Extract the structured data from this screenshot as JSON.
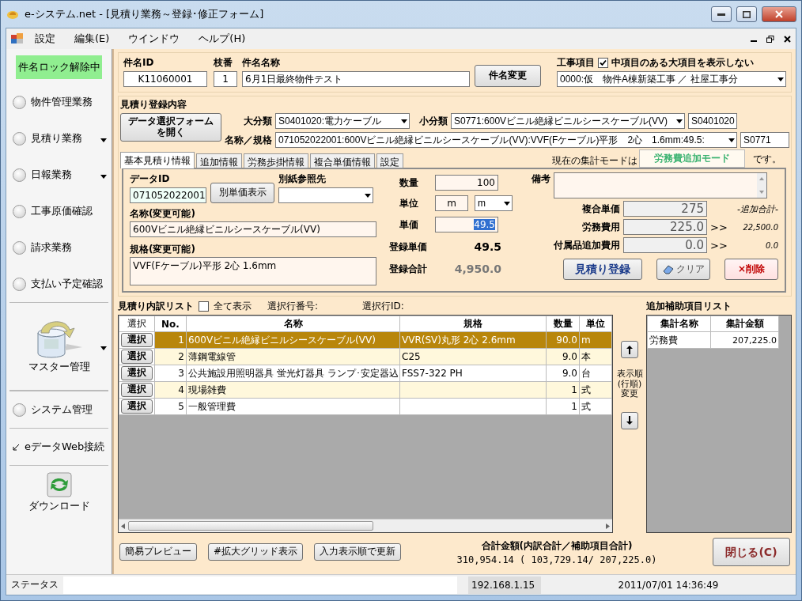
{
  "window": {
    "title": "e-システム.net - [見積り業務～登録･修正フォーム]"
  },
  "menu": [
    {
      "label": "設定"
    },
    {
      "label": "編集(E)"
    },
    {
      "label": "ウインドウ"
    },
    {
      "label": "ヘルプ(H)"
    }
  ],
  "sidebar": {
    "lock_badge": "件名ロック解除中",
    "items": [
      {
        "kind": "radio",
        "label": "物件管理業務",
        "selected": false,
        "has_menu": false
      },
      {
        "kind": "radio",
        "label": "見積り業務",
        "selected": false,
        "has_menu": true
      },
      {
        "kind": "radio",
        "label": "日報業務",
        "selected": false,
        "has_menu": true
      },
      {
        "kind": "radio",
        "label": "工事原価確認",
        "selected": false,
        "has_menu": false
      },
      {
        "kind": "radio",
        "label": "請求業務",
        "selected": false,
        "has_menu": false
      },
      {
        "kind": "radio",
        "label": "支払い予定確認",
        "selected": false,
        "has_menu": false
      },
      {
        "kind": "large",
        "label": "マスター管理",
        "has_menu": true
      },
      {
        "kind": "radio",
        "label": "システム管理",
        "selected": false,
        "has_menu": false
      },
      {
        "kind": "link",
        "label": "eデータWeb接続"
      },
      {
        "kind": "download",
        "label": "ダウンロード"
      }
    ]
  },
  "header": {
    "case_id_label": "件名ID",
    "case_id": "K11060001",
    "branch_label": "枝番",
    "branch": "1",
    "case_name_label": "件名名称",
    "case_name": "6月1日最終物件テスト",
    "change_button": "件名変更",
    "work_label": "工事項目",
    "hide_checkbox": {
      "label": "中項目のある大項目を表示しない",
      "checked": true
    },
    "work_select": "0000:仮　物件A棟新築工事 ／ 社屋工事分"
  },
  "registration": {
    "title": "見積り登録内容",
    "open_button": [
      "データ選択フォーム",
      "を開く"
    ],
    "major_label": "大分類",
    "major_select": "S0401020:電力ケーブル",
    "minor_label": "小分類",
    "minor_select": "S0771:600Vビニル絶縁ビニルシースケーブル(VV)",
    "major_code": "S0401020",
    "name_label": "名称／規格",
    "name_select": "071052022001:600Vビニル絶縁ビニルシースケーブル(VV):VVF(Fケーブル)平形　2心　1.6mm:49.5:",
    "minor_code": "S0771",
    "tabs": [
      {
        "label": "基本見積り情報",
        "selected": true
      },
      {
        "label": "追加情報",
        "selected": false
      },
      {
        "label": "労務歩掛情報",
        "selected": false
      },
      {
        "label": "複合単価情報",
        "selected": false
      },
      {
        "label": "設定",
        "selected": false
      }
    ],
    "mode_prefix": "現在の集計モードは",
    "mode": "労務費追加モード",
    "mode_suffix": "です。"
  },
  "basic": {
    "data_id_label": "データID",
    "data_id": "071052022001",
    "alt_price_button": "別単価表示",
    "ref_label": "別紙参照先",
    "name_label": "名称(変更可能)",
    "name": "600Vビニル絶縁ビニルシースケーブル(VV)",
    "spec_label": "規格(変更可能)",
    "spec": "VVF(Fケーブル)平形 2心 1.6mm",
    "qty_label": "数量",
    "qty": "100",
    "unit_label": "単位",
    "unit": "m",
    "unit_select": "m",
    "price_label": "単価",
    "price": "49.5",
    "reg_price_label": "登録単価",
    "reg_price": "49.5",
    "reg_total_label": "登録合計",
    "reg_total": "4,950.0",
    "note_label": "備考",
    "composite_label": "複合単価",
    "composite": "275",
    "extra_total_label": "-追加合計-",
    "labor_label": "労務費用",
    "labor": "225.0",
    "labor_arrow": ">>",
    "labor_total": "22,500.0",
    "parts_label": "付属品追加費用",
    "parts": "0.0",
    "parts_arrow": ">>",
    "parts_total": "0.0",
    "register_button": "見積り登録",
    "clear_button": "クリア",
    "delete_button": "×削除"
  },
  "list": {
    "title": "見積り内訳リスト",
    "show_all": {
      "label": "全て表示",
      "checked": false
    },
    "row_no_label": "選択行番号:",
    "row_id_label": "選択行ID:",
    "columns": [
      "選択",
      "No.",
      "名称",
      "規格",
      "数量",
      "単位"
    ],
    "rows": [
      {
        "button": "選択",
        "no": "1",
        "name": "600Vビニル絶縁ビニルシースケーブル(VV)",
        "spec": "VVR(SV)丸形 2心 2.6mm",
        "qty": "90.0",
        "unit": "m",
        "selected": true
      },
      {
        "button": "選択",
        "no": "2",
        "name": "薄鋼電線管",
        "spec": "C25",
        "qty": "9.0",
        "unit": "本",
        "selected": false
      },
      {
        "button": "選択",
        "no": "3",
        "name": "公共施設用照明器具 蛍光灯器具 ランプ･安定器込",
        "spec": "FSS7-322 PH",
        "qty": "9.0",
        "unit": "台",
        "selected": false
      },
      {
        "button": "選択",
        "no": "4",
        "name": "現場雑費",
        "spec": "",
        "qty": "1",
        "unit": "式",
        "selected": false
      },
      {
        "button": "選択",
        "no": "5",
        "name": "一般管理費",
        "spec": "",
        "qty": "1",
        "unit": "式",
        "selected": false
      }
    ],
    "order_label": "表示順(行順)変更"
  },
  "aux": {
    "title": "追加補助項目リスト",
    "columns": [
      "集計名称",
      "集計金額"
    ],
    "rows": [
      {
        "name": "労務費",
        "amount": "207,225.0"
      }
    ]
  },
  "footer": {
    "buttons": [
      "簡易プレビュー",
      "#拡大グリッド表示",
      "入力表示順で更新"
    ],
    "total_label": "合計金額(内訳合計／補助項目合計)",
    "total": "310,954.14 ( 103,729.14/ 207,225.0)",
    "close_button": "閉じる(C)"
  },
  "status_bar": {
    "label": "ステータス",
    "ip": "192.168.1.15",
    "datetime": "2011/07/01 14:36:49"
  }
}
